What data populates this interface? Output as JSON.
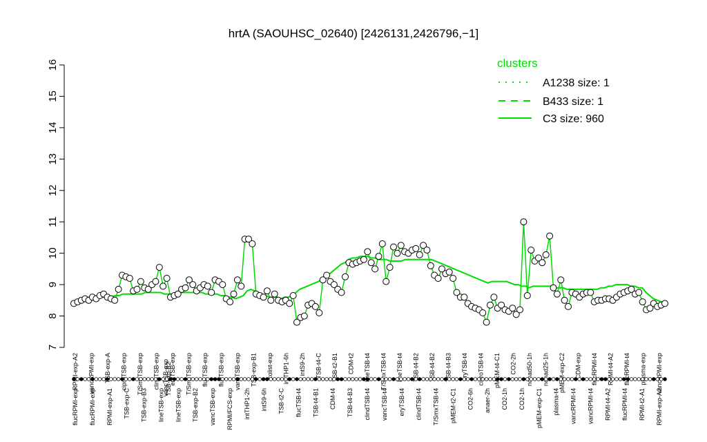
{
  "chart_data": {
    "type": "line",
    "title": "hrtA (SAOUHSC_02640) [2426131,2426796,−1]",
    "ylim": [
      7,
      16
    ],
    "yticks": [
      7,
      8,
      9,
      10,
      11,
      12,
      13,
      14,
      15,
      16
    ],
    "legend": {
      "title": "clusters",
      "placement": "top-right",
      "entries": [
        {
          "label": "A1238 size: 1",
          "style": "dotted"
        },
        {
          "label": "B433 size: 1",
          "style": "dashed"
        },
        {
          "label": "C3 size: 960",
          "style": "solid"
        }
      ]
    },
    "colors": {
      "line": "#00dd00",
      "point_fill": "#ffffff",
      "point_edge": "#000000"
    },
    "x_labels_top": [
      "RPMI-exp-A2",
      "vancRPMI-exp",
      "TSB-exp-A",
      "ciproTSB-exp",
      "T/SmxTSB-exp",
      "clindTSB-exp",
      "eryTSB-exp",
      "T/SmxTSB-exp",
      "flucTSB-exp",
      "flucTSB-exp",
      "vancTSB-exp",
      "TSB-exp-B1",
      "colist-exp",
      "intTHP1-6h",
      "intS9-2h",
      "TSB-t4-C",
      "TSB-t2-B1",
      "CDM-t2",
      "lineTSB-t4",
      "T/SmxTSB-t4",
      "lineTSB-t4",
      "TSB-t4-B2",
      "TSB-t4-B2",
      "TSB-t4-B3",
      "eryTSB-t4",
      "ciproTSB-t4",
      "pMEM-t4-C1",
      "CO2-2h",
      "nonad50-1h",
      "nonad25-1h",
      "pMEM-exp-C2",
      "CDM-exp",
      "flucRPMI-t4",
      "RPMI-t4-A2",
      "flucRPMI-t4",
      "plasma-exp",
      "vancRPMI-exp"
    ],
    "x_labels_bottom": [
      "flucRPMI-exp",
      "flucRPMI-exp",
      "RPMI-exp-A1",
      "TSB-exp-C",
      "TSB-exp-B3",
      "lineTSB-exp",
      "lineTSB-exp",
      "TSB-exp-B2",
      "vancTSB-exp",
      "RPMI/FCS-exp",
      "intTHP1-2h",
      "intS9-6h",
      "TSB-t2-C",
      "flucTSB-t4",
      "TSB-t4-B1",
      "CDM-t4",
      "TSB-t4-B3",
      "clindTSB-t4",
      "vancTSB-t4",
      "eryTSB-t4",
      "clindTSB-t4",
      "T/SmxTSB-t4",
      "pMEM-t2-C1",
      "CO2-6h",
      "anaer-2h",
      "CO2-1h",
      "CO2-1h",
      "pMEM-exp-C1",
      "plasma-t4",
      "vancRPMI-t4",
      "vancRPMI-t4",
      "RPMI-t4-A2",
      "flucRPMI-t4",
      "RPMI-t2-A1",
      "RPMI-exp-A2"
    ],
    "x_labels_mid": [
      "vancTSB-exp",
      "TSB-exp-B2"
    ],
    "points": [
      8.4,
      8.45,
      8.5,
      8.55,
      8.5,
      8.6,
      8.55,
      8.65,
      8.7,
      8.6,
      8.55,
      8.5,
      8.85,
      9.3,
      9.25,
      9.2,
      8.8,
      8.85,
      9.1,
      8.9,
      8.85,
      9.0,
      9.1,
      9.55,
      8.95,
      9.2,
      8.6,
      8.65,
      8.7,
      8.85,
      8.9,
      9.15,
      9.0,
      8.8,
      8.9,
      9.0,
      8.95,
      8.75,
      9.15,
      9.1,
      9.0,
      8.55,
      8.45,
      8.7,
      9.15,
      8.95,
      10.45,
      10.45,
      10.3,
      8.7,
      8.65,
      8.6,
      8.8,
      8.5,
      8.7,
      8.5,
      8.45,
      8.5,
      8.4,
      8.65,
      7.8,
      7.95,
      8.0,
      8.35,
      8.4,
      8.3,
      8.1,
      9.15,
      9.3,
      9.1,
      9.0,
      8.85,
      8.75,
      9.25,
      9.7,
      9.65,
      9.7,
      9.75,
      9.8,
      10.05,
      9.7,
      9.5,
      9.9,
      10.3,
      9.1,
      9.55,
      10.2,
      10.0,
      10.25,
      10.05,
      10.0,
      10.1,
      10.15,
      9.95,
      10.25,
      10.1,
      9.6,
      9.3,
      9.2,
      9.5,
      9.35,
      9.4,
      9.2,
      8.75,
      8.6,
      8.6,
      8.4,
      8.3,
      8.25,
      8.2,
      8.1,
      7.8,
      8.35,
      8.6,
      8.25,
      8.35,
      8.2,
      8.15,
      8.25,
      8.05,
      8.2,
      11.0,
      8.65,
      10.1,
      9.75,
      9.85,
      9.7,
      9.95,
      10.55,
      8.9,
      8.7,
      9.15,
      8.5,
      8.3,
      8.75,
      8.7,
      8.6,
      8.7,
      8.75,
      8.75,
      8.45,
      8.5,
      8.5,
      8.55,
      8.55,
      8.5,
      8.6,
      8.7,
      8.75,
      8.8,
      8.85,
      8.7,
      8.75,
      8.45,
      8.2,
      8.25,
      8.4,
      8.3,
      8.35,
      8.4
    ],
    "cluster_line": [
      8.45,
      8.5,
      8.55,
      8.55,
      8.6,
      8.6,
      8.6,
      8.6,
      8.6,
      8.6,
      8.6,
      8.65,
      8.65,
      8.7,
      8.7,
      8.7,
      8.7,
      8.7,
      8.7,
      8.75,
      8.75,
      8.75,
      8.75,
      8.75,
      8.7,
      8.7,
      8.7,
      8.7,
      8.75,
      8.75,
      8.75,
      8.75,
      8.75,
      8.75,
      8.75,
      8.7,
      8.7,
      8.7,
      8.7,
      8.65,
      8.65,
      8.6,
      8.6,
      8.55,
      8.6,
      8.65,
      8.8,
      8.85,
      8.8,
      8.75,
      8.7,
      8.65,
      8.6,
      8.6,
      8.6,
      8.55,
      8.6,
      8.6,
      8.65,
      8.75,
      8.85,
      8.9,
      8.95,
      9.0,
      9.05,
      9.1,
      9.2,
      9.3,
      9.35,
      9.45,
      9.55,
      9.65,
      9.7,
      9.8,
      9.85,
      9.85,
      9.9,
      9.9,
      9.9,
      9.85,
      9.85,
      9.8,
      9.8,
      9.8,
      9.75,
      9.75,
      9.75,
      9.75,
      9.8,
      9.8,
      9.8,
      9.8,
      9.8,
      9.8,
      9.8,
      9.8,
      9.75,
      9.7,
      9.65,
      9.6,
      9.55,
      9.5,
      9.45,
      9.4,
      9.35,
      9.3,
      9.25,
      9.2,
      9.15,
      9.1,
      9.05,
      9.1,
      9.1,
      9.1,
      9.1,
      9.1,
      9.05,
      9.0,
      9.0,
      8.95,
      8.95,
      8.9,
      8.95,
      8.95,
      8.95,
      8.95,
      8.95,
      8.95,
      8.9,
      8.9,
      8.9,
      8.85,
      8.85,
      8.85,
      8.85,
      8.85,
      8.85,
      8.85,
      8.85,
      8.85,
      8.9,
      8.9,
      8.95,
      8.95,
      9.0,
      9.0,
      9.0,
      9.0,
      8.95,
      8.95,
      8.9,
      8.9,
      8.75,
      8.65,
      8.55,
      8.5,
      8.45,
      8.45
    ]
  }
}
